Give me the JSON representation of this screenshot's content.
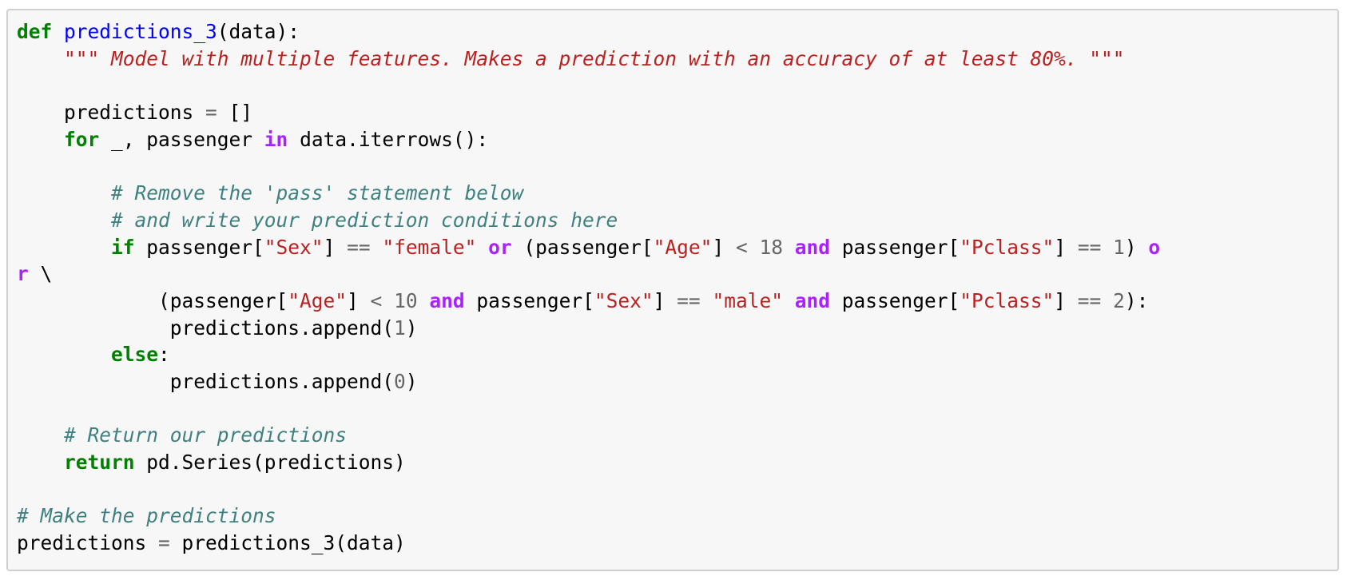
{
  "code_cell": {
    "lines": [
      [
        {
          "t": "def",
          "c": "kw"
        },
        {
          "t": " ",
          "c": "pl"
        },
        {
          "t": "predictions_3",
          "c": "fn"
        },
        {
          "t": "(data):",
          "c": "pl"
        }
      ],
      [
        {
          "t": "    ",
          "c": "pl"
        },
        {
          "t": "\"\"\" Model with multiple features. Makes a prediction with an accuracy of at least 80%. \"\"\"",
          "c": "doc"
        }
      ],
      [],
      [
        {
          "t": "    predictions ",
          "c": "pl"
        },
        {
          "t": "=",
          "c": "sym"
        },
        {
          "t": " []",
          "c": "pl"
        }
      ],
      [
        {
          "t": "    ",
          "c": "pl"
        },
        {
          "t": "for",
          "c": "kw"
        },
        {
          "t": " _, passenger ",
          "c": "pl"
        },
        {
          "t": "in",
          "c": "op"
        },
        {
          "t": " data.iterrows():",
          "c": "pl"
        }
      ],
      [],
      [
        {
          "t": "        ",
          "c": "pl"
        },
        {
          "t": "# Remove the 'pass' statement below",
          "c": "com"
        }
      ],
      [
        {
          "t": "        ",
          "c": "pl"
        },
        {
          "t": "# and write your prediction conditions here",
          "c": "com"
        }
      ],
      [
        {
          "t": "        ",
          "c": "pl"
        },
        {
          "t": "if",
          "c": "kw"
        },
        {
          "t": " passenger[",
          "c": "pl"
        },
        {
          "t": "\"Sex\"",
          "c": "str"
        },
        {
          "t": "] ",
          "c": "pl"
        },
        {
          "t": "==",
          "c": "sym"
        },
        {
          "t": " ",
          "c": "pl"
        },
        {
          "t": "\"female\"",
          "c": "str"
        },
        {
          "t": " ",
          "c": "pl"
        },
        {
          "t": "or",
          "c": "op"
        },
        {
          "t": " (passenger[",
          "c": "pl"
        },
        {
          "t": "\"Age\"",
          "c": "str"
        },
        {
          "t": "] ",
          "c": "pl"
        },
        {
          "t": "<",
          "c": "sym"
        },
        {
          "t": " ",
          "c": "pl"
        },
        {
          "t": "18",
          "c": "num"
        },
        {
          "t": " ",
          "c": "pl"
        },
        {
          "t": "and",
          "c": "op"
        },
        {
          "t": " passenger[",
          "c": "pl"
        },
        {
          "t": "\"Pclass\"",
          "c": "str"
        },
        {
          "t": "] ",
          "c": "pl"
        },
        {
          "t": "==",
          "c": "sym"
        },
        {
          "t": " ",
          "c": "pl"
        },
        {
          "t": "1",
          "c": "num"
        },
        {
          "t": ") ",
          "c": "pl"
        },
        {
          "t": "o",
          "c": "op"
        }
      ],
      [
        {
          "t": "r",
          "c": "op"
        },
        {
          "t": " \\",
          "c": "pl"
        }
      ],
      [
        {
          "t": "            (passenger[",
          "c": "pl"
        },
        {
          "t": "\"Age\"",
          "c": "str"
        },
        {
          "t": "] ",
          "c": "pl"
        },
        {
          "t": "<",
          "c": "sym"
        },
        {
          "t": " ",
          "c": "pl"
        },
        {
          "t": "10",
          "c": "num"
        },
        {
          "t": " ",
          "c": "pl"
        },
        {
          "t": "and",
          "c": "op"
        },
        {
          "t": " passenger[",
          "c": "pl"
        },
        {
          "t": "\"Sex\"",
          "c": "str"
        },
        {
          "t": "] ",
          "c": "pl"
        },
        {
          "t": "==",
          "c": "sym"
        },
        {
          "t": " ",
          "c": "pl"
        },
        {
          "t": "\"male\"",
          "c": "str"
        },
        {
          "t": " ",
          "c": "pl"
        },
        {
          "t": "and",
          "c": "op"
        },
        {
          "t": " passenger[",
          "c": "pl"
        },
        {
          "t": "\"Pclass\"",
          "c": "str"
        },
        {
          "t": "] ",
          "c": "pl"
        },
        {
          "t": "==",
          "c": "sym"
        },
        {
          "t": " ",
          "c": "pl"
        },
        {
          "t": "2",
          "c": "num"
        },
        {
          "t": "):",
          "c": "pl"
        }
      ],
      [
        {
          "t": "             predictions.append(",
          "c": "pl"
        },
        {
          "t": "1",
          "c": "num"
        },
        {
          "t": ")",
          "c": "pl"
        }
      ],
      [
        {
          "t": "        ",
          "c": "pl"
        },
        {
          "t": "else",
          "c": "kw"
        },
        {
          "t": ":",
          "c": "pl"
        }
      ],
      [
        {
          "t": "             predictions.append(",
          "c": "pl"
        },
        {
          "t": "0",
          "c": "num"
        },
        {
          "t": ")",
          "c": "pl"
        }
      ],
      [],
      [
        {
          "t": "    ",
          "c": "pl"
        },
        {
          "t": "# Return our predictions",
          "c": "com"
        }
      ],
      [
        {
          "t": "    ",
          "c": "pl"
        },
        {
          "t": "return",
          "c": "kw"
        },
        {
          "t": " pd.Series(predictions)",
          "c": "pl"
        }
      ],
      [],
      [
        {
          "t": "# Make the predictions",
          "c": "com"
        }
      ],
      [
        {
          "t": "predictions ",
          "c": "pl"
        },
        {
          "t": "=",
          "c": "sym"
        },
        {
          "t": " predictions_3(data)",
          "c": "pl"
        }
      ]
    ]
  }
}
